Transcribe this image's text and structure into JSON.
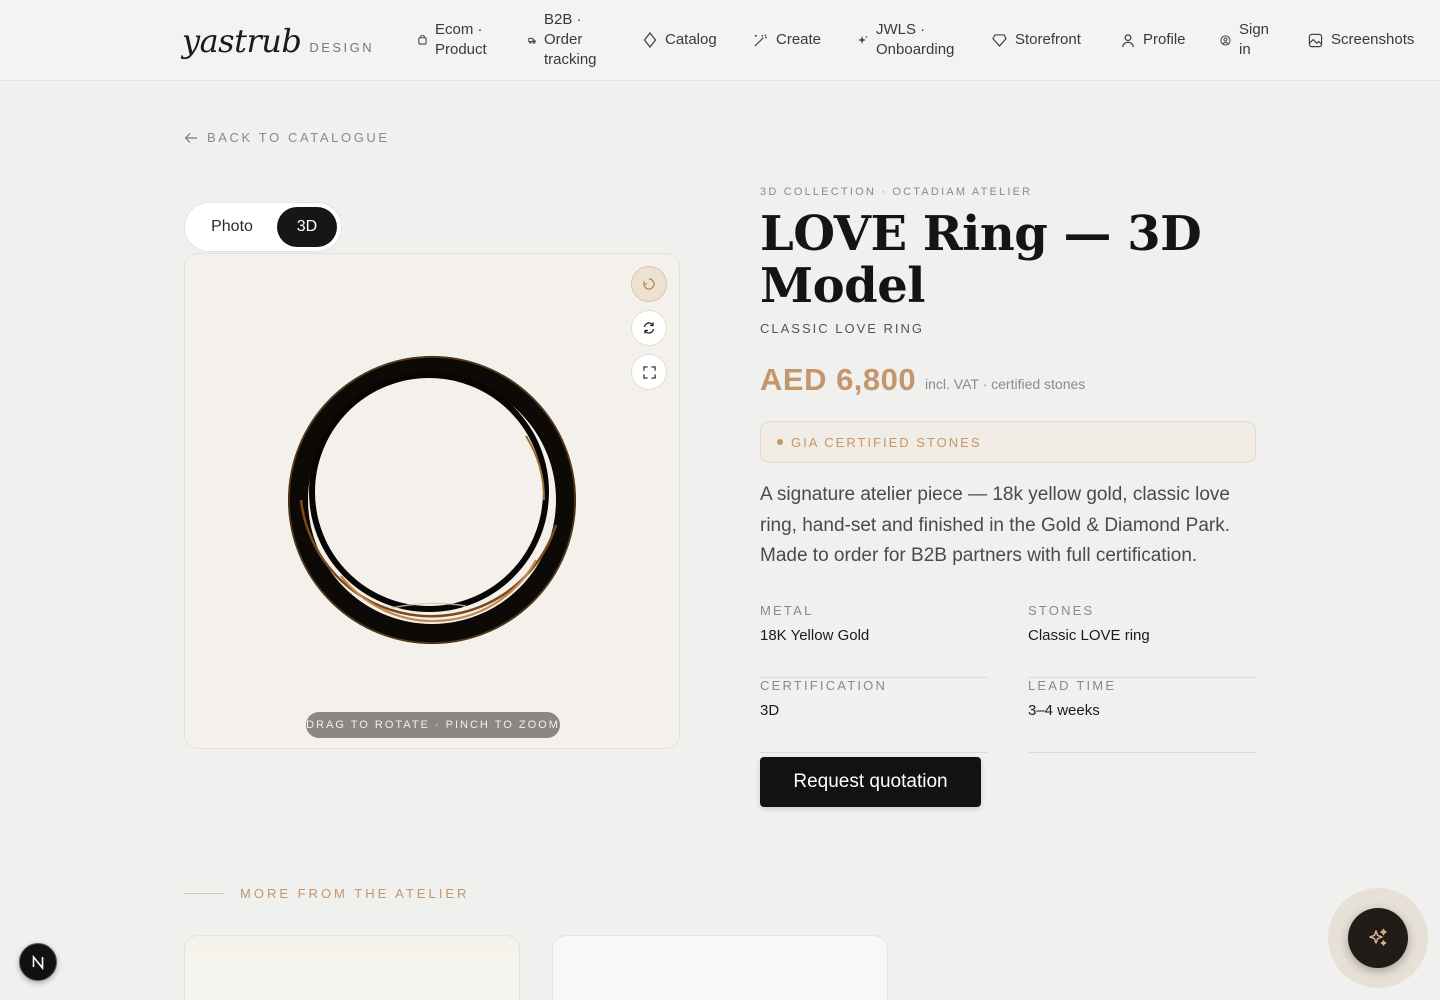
{
  "header": {
    "logo": "yastrub",
    "logo_sub": "DESIGN",
    "nav": [
      {
        "label": "Ecom · Product",
        "icon": "bag-icon"
      },
      {
        "label": "B2B · Order tracking",
        "icon": "truck-icon"
      },
      {
        "label": "Catalog",
        "icon": "diamond-icon"
      },
      {
        "label": "Create",
        "icon": "magic-wand-icon"
      },
      {
        "label": "JWLS · Onboarding",
        "icon": "sparkle-icon"
      },
      {
        "label": "Storefront",
        "icon": "gem-icon"
      },
      {
        "label": "Profile",
        "icon": "user-icon"
      },
      {
        "label": "Sign in",
        "icon": "user-circle-icon"
      },
      {
        "label": "Screenshots",
        "icon": "image-icon"
      }
    ]
  },
  "back_link": "BACK TO CATALOGUE",
  "viewer": {
    "toggle": {
      "photo": "Photo",
      "model": "3D",
      "selected": "3D"
    },
    "hint": "DRAG TO ROTATE · PINCH TO ZOOM",
    "ring_color": "#0d0a07",
    "ring_highlight": "#c48a4a"
  },
  "product": {
    "eyebrow": "3D COLLECTION · OCTADIAM ATELIER",
    "title": "LOVE Ring — 3D Model",
    "subtitle": "CLASSIC LOVE RING",
    "price": "AED 6,800",
    "price_note": "incl. VAT · certified stones",
    "badge": "GIA CERTIFIED STONES",
    "description": "A signature atelier piece — 18k yellow gold, classic love ring, hand-set and finished in the Gold & Diamond Park. Made to order for B2B partners with full certification.",
    "specs": [
      {
        "label": "METAL",
        "value": "18K Yellow Gold"
      },
      {
        "label": "STONES",
        "value": "Classic LOVE ring"
      },
      {
        "label": "CERTIFICATION",
        "value": "3D"
      },
      {
        "label": "LEAD TIME",
        "value": "3–4 weeks"
      }
    ],
    "cta": "Request quotation"
  },
  "more": {
    "heading": "MORE FROM THE ATELIER"
  },
  "colors": {
    "accent": "#c4966c",
    "background": "#f0f0ef",
    "dark": "#121212"
  }
}
